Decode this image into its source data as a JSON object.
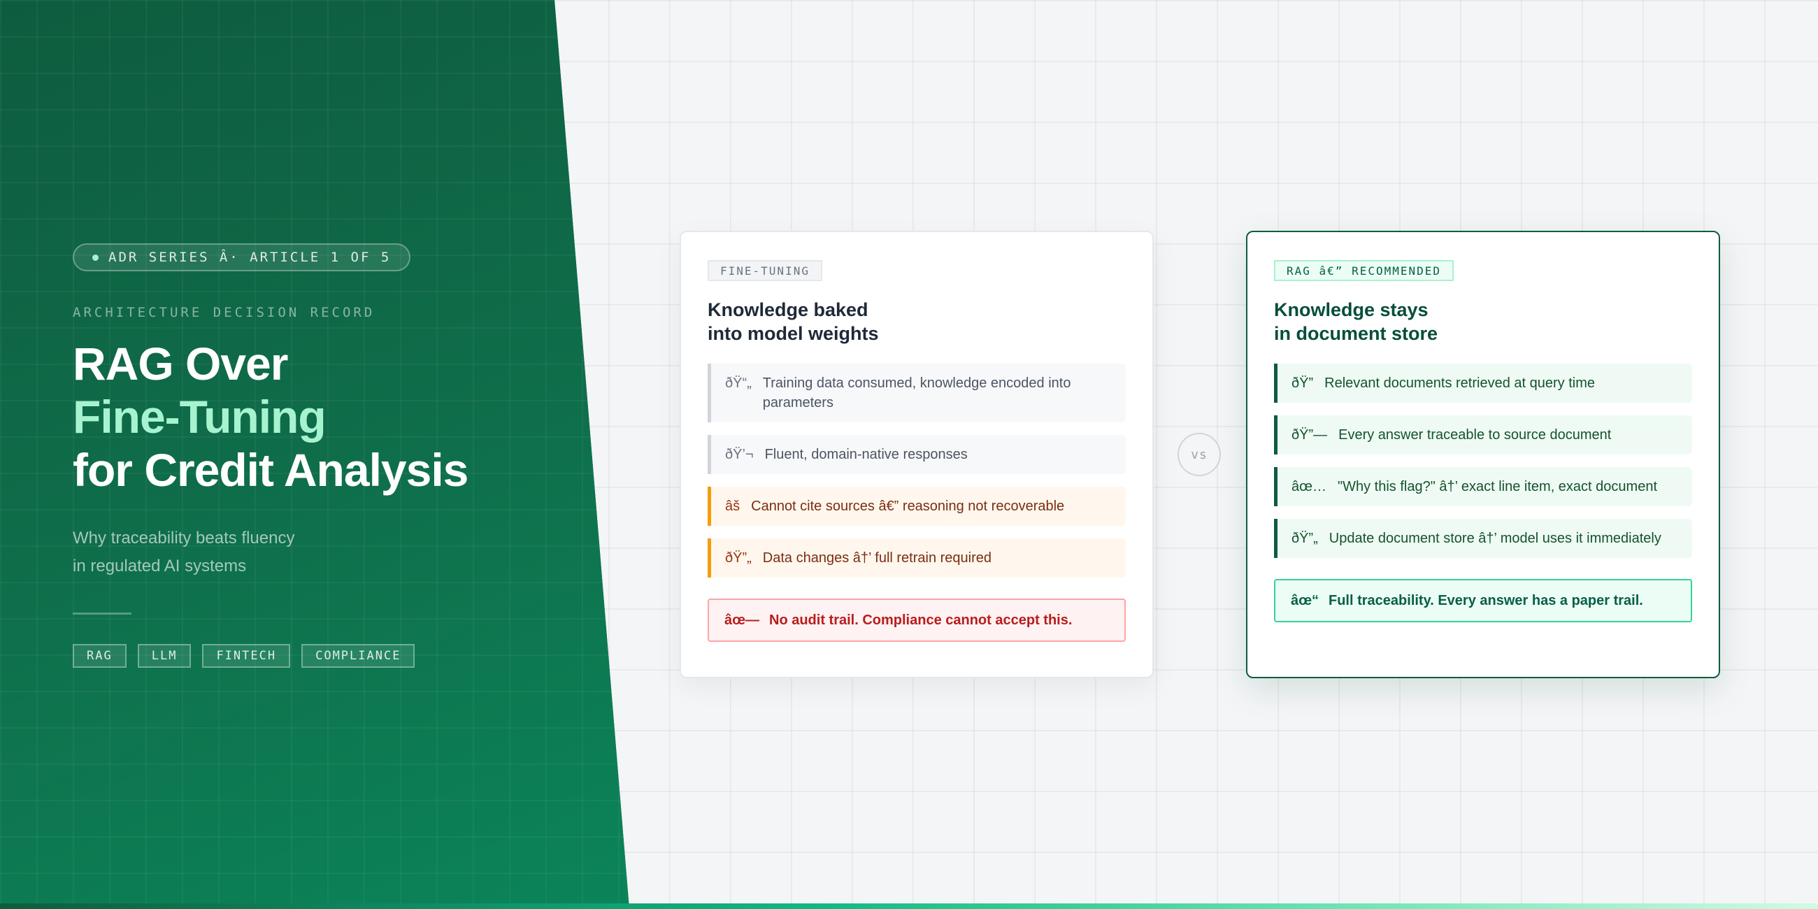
{
  "hero": {
    "series": "ADR SERIES Â· ARTICLE 1 OF 5",
    "eyebrow": "ARCHITECTURE DECISION RECORD",
    "title_line1": "RAG Over",
    "title_line2": "Fine-Tuning",
    "title_line3": "for Credit Analysis",
    "subtitle_line1": "Why traceability beats fluency",
    "subtitle_line2": "in regulated AI systems",
    "tags": [
      "RAG",
      "LLM",
      "FINTECH",
      "COMPLIANCE"
    ]
  },
  "fine_tuning": {
    "badge": "FINE-TUNING",
    "title_line1": "Knowledge baked",
    "title_line2": "into model weights",
    "items": [
      {
        "icon": "ðŸ“„",
        "text": "Training data consumed, knowledge encoded into parameters"
      },
      {
        "icon": "ðŸ’¬",
        "text": "Fluent, domain-native responses"
      },
      {
        "icon": "âš",
        "text": "Cannot cite sources â€” reasoning not recoverable"
      },
      {
        "icon": "ðŸ”„",
        "text": "Data changes â†’ full retrain required"
      }
    ],
    "alert_icon": "âœ—",
    "alert_text": "No audit trail. Compliance cannot accept this."
  },
  "vs": "vs",
  "rag": {
    "badge": "RAG â€” RECOMMENDED",
    "title_line1": "Knowledge stays",
    "title_line2": "in document store",
    "items": [
      {
        "icon": "ðŸ”",
        "text": "Relevant documents retrieved at query time"
      },
      {
        "icon": "ðŸ”—",
        "text": "Every answer traceable to source document"
      },
      {
        "icon": "âœ…",
        "text": "\"Why this flag?\" â†’ exact line item, exact document"
      },
      {
        "icon": "ðŸ”„",
        "text": "Update document store â†’ model uses it immediately"
      }
    ],
    "success_icon": "âœ“",
    "success_text": "Full traceability. Every answer has a paper trail."
  },
  "colors": {
    "brand_green": "#0e5c3f",
    "accent_mint": "#a7f3d0",
    "warning": "#f59e0b",
    "danger": "#b91c1c"
  }
}
